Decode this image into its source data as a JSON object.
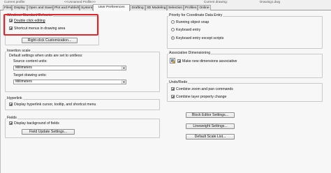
{
  "top_strip": {
    "left": "Current profile:",
    "mid": "<<Unnamed Profile>>",
    "right1": "Current drawing:",
    "right2": "Drawing1.dwg"
  },
  "tabs": [
    {
      "label": "Files"
    },
    {
      "label": "Display"
    },
    {
      "label": "Open and Save"
    },
    {
      "label": "Plot and Publish"
    },
    {
      "label": "System"
    },
    {
      "label": "User Preferences",
      "active": true
    },
    {
      "label": "Drafting"
    },
    {
      "label": "3D Modeling"
    },
    {
      "label": "Selection"
    },
    {
      "label": "Profiles"
    },
    {
      "label": "Online"
    }
  ],
  "wsb": {
    "title": "Windows Standard Behavior",
    "double_click": "Double click editing",
    "shortcut_menus": "Shortcut menus in drawing area",
    "right_click_btn": "Right-click Customization..."
  },
  "insertion": {
    "title": "Insertion scale",
    "desc": "Default settings when units are set to unitless:",
    "source_label": "Source content units:",
    "source_value": "Millimeters",
    "target_label": "Target drawing units:",
    "target_value": "Millimeters"
  },
  "hyperlink": {
    "title": "Hyperlink",
    "display": "Display hyperlink cursor, tooltip, and shortcut menu"
  },
  "fields": {
    "title": "Fields",
    "display_bg": "Display background of fields",
    "update_btn": "Field Update Settings..."
  },
  "priority": {
    "title": "Priority for Coordinate Data Entry",
    "opt1": "Running object snap",
    "opt2": "Keyboard entry",
    "opt3": "Keyboard entry except scripts"
  },
  "assoc": {
    "title": "Associative Dimensioning",
    "make_new": "Make new dimensions associative"
  },
  "undo": {
    "title": "Undo/Redo",
    "combine_zoom": "Combine zoom and pan commands",
    "combine_layer": "Combine layer property change"
  },
  "right_buttons": {
    "block_editor": "Block Editor Settings...",
    "lineweight": "Lineweight Settings...",
    "scale_list": "Default Scale List..."
  }
}
